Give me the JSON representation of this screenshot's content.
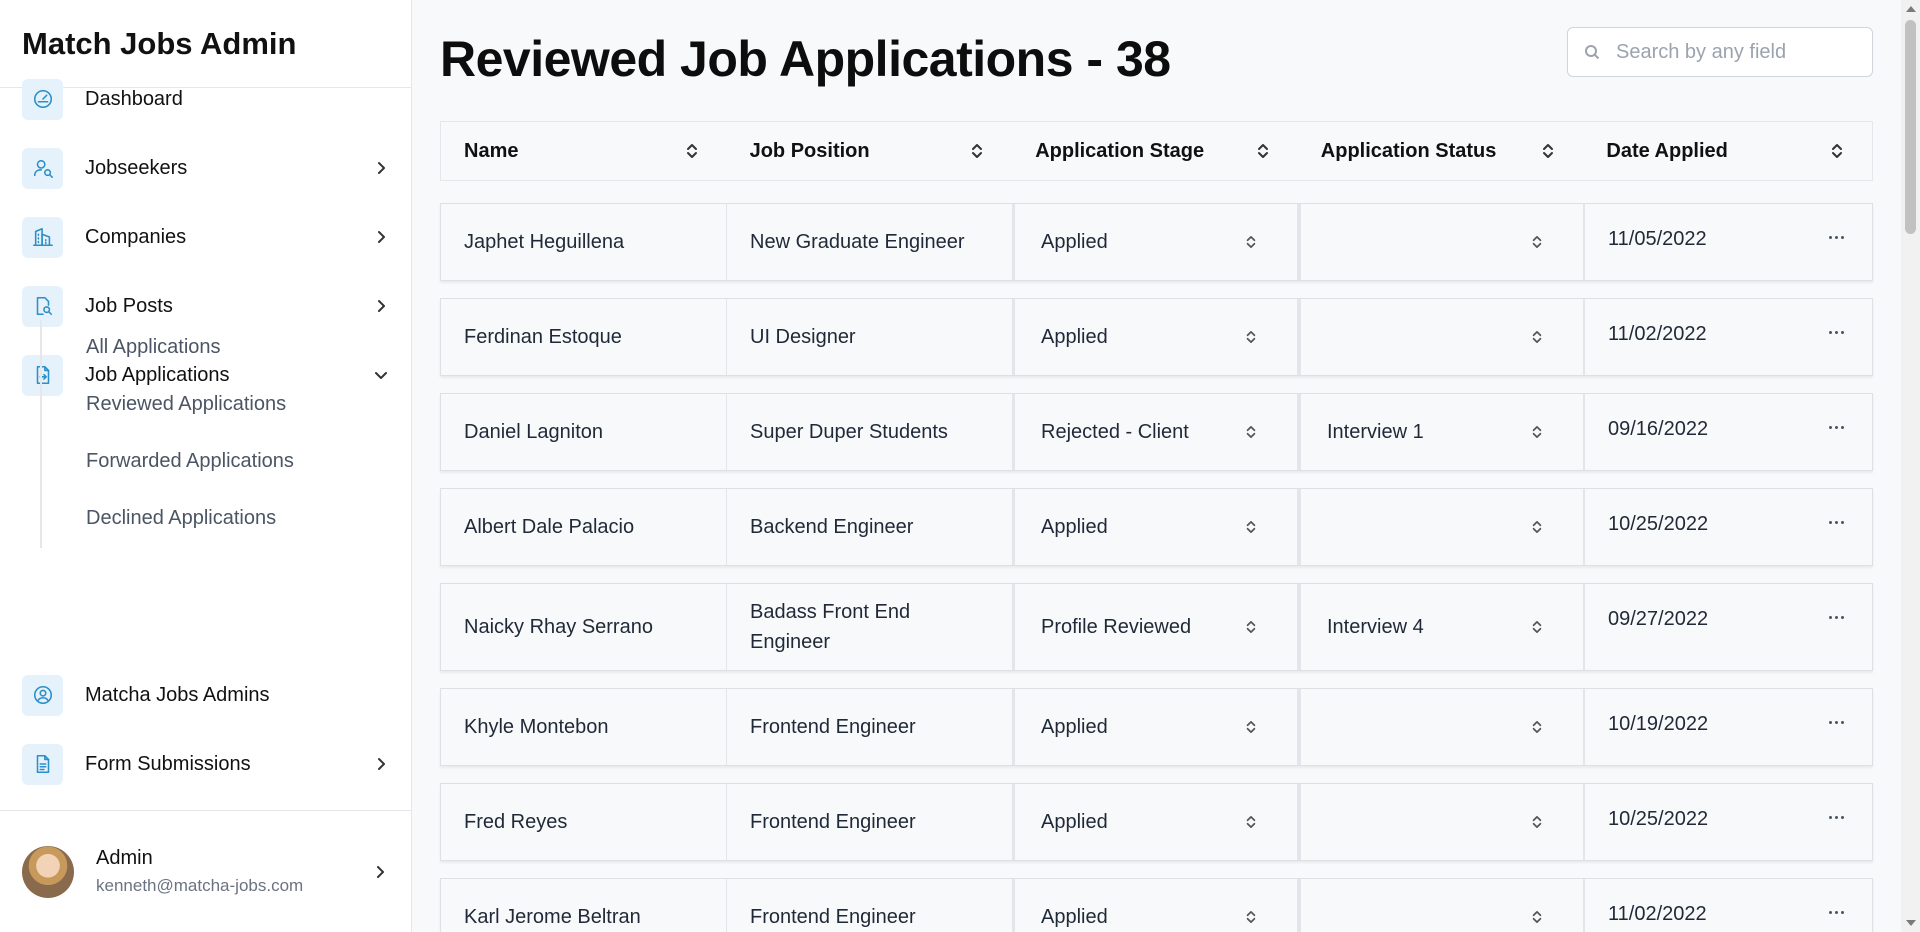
{
  "app": {
    "title": "Match Jobs Admin"
  },
  "sidebar": {
    "items": [
      {
        "label": "Dashboard",
        "icon": "gauge-icon",
        "has_chevron": false
      },
      {
        "label": "Jobseekers",
        "icon": "user-search-icon",
        "has_chevron": true
      },
      {
        "label": "Companies",
        "icon": "building-icon",
        "has_chevron": true
      },
      {
        "label": "Job Posts",
        "icon": "document-search-icon",
        "has_chevron": true
      },
      {
        "label": "Job Applications",
        "icon": "document-arrow-icon",
        "has_chevron": true,
        "expanded": true
      },
      {
        "label": "Matcha Jobs Admins",
        "icon": "user-circle-icon",
        "has_chevron": false
      },
      {
        "label": "Form Submissions",
        "icon": "document-lines-icon",
        "has_chevron": true
      }
    ],
    "subitems": [
      {
        "label": "All Applications"
      },
      {
        "label": "Reviewed Applications"
      },
      {
        "label": "Forwarded Applications"
      },
      {
        "label": "Declined Applications"
      }
    ]
  },
  "profile": {
    "name": "Admin",
    "email": "kenneth@matcha-jobs.com"
  },
  "header": {
    "title": "Reviewed Job Applications - 38"
  },
  "search": {
    "placeholder": "Search by any field",
    "value": ""
  },
  "table": {
    "columns": [
      "Name",
      "Job Position",
      "Application Stage",
      "Application Status",
      "Date Applied"
    ],
    "rows": [
      {
        "name": "Japhet Heguillena",
        "position": "New Graduate Engineer",
        "stage": "Applied",
        "status": "",
        "date": "11/05/2022"
      },
      {
        "name": "Ferdinan Estoque",
        "position": "UI Designer",
        "stage": "Applied",
        "status": "",
        "date": "11/02/2022"
      },
      {
        "name": "Daniel Lagniton",
        "position": "Super Duper Students",
        "stage": "Rejected - Client",
        "status": "Interview 1",
        "date": "09/16/2022"
      },
      {
        "name": "Albert Dale Palacio",
        "position": "Backend Engineer",
        "stage": "Applied",
        "status": "",
        "date": "10/25/2022"
      },
      {
        "name": "Naicky Rhay Serrano",
        "position": "Badass Front End Engineer",
        "stage": "Profile Reviewed",
        "status": "Interview 4",
        "date": "09/27/2022"
      },
      {
        "name": "Khyle Montebon",
        "position": "Frontend Engineer",
        "stage": "Applied",
        "status": "",
        "date": "10/19/2022"
      },
      {
        "name": "Fred Reyes",
        "position": "Frontend Engineer",
        "stage": "Applied",
        "status": "",
        "date": "10/25/2022"
      },
      {
        "name": "Karl Jerome Beltran",
        "position": "Frontend Engineer",
        "stage": "Applied",
        "status": "",
        "date": "11/02/2022"
      }
    ]
  },
  "colors": {
    "accent": "#2b8fc8",
    "icon_bg": "#e6f2fb",
    "page_bg": "#f8f9fa"
  }
}
